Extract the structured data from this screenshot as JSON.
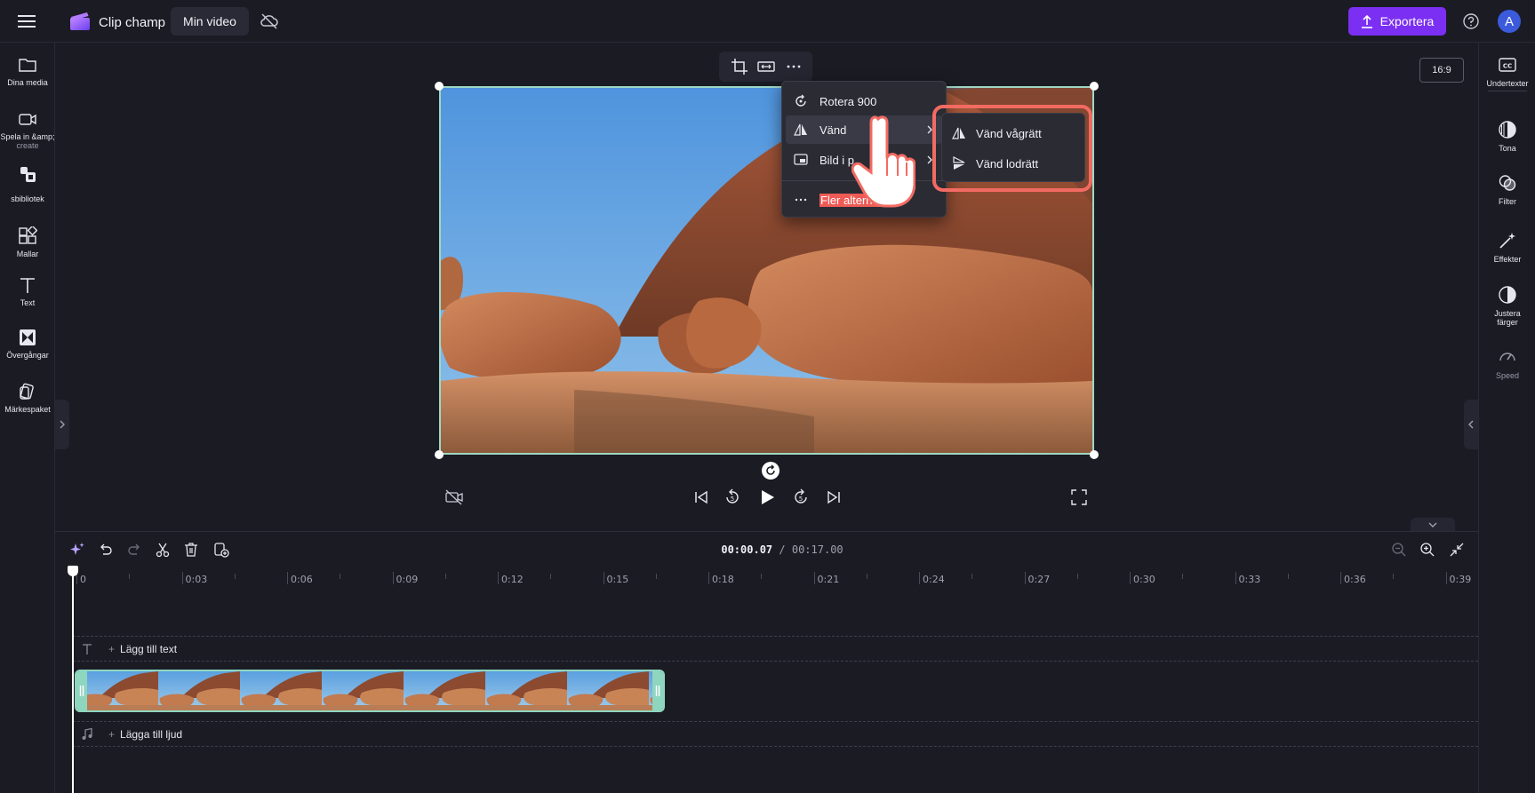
{
  "app": {
    "name": "Clip champ",
    "project_tab": "Min video"
  },
  "header": {
    "export_label": "Exportera",
    "avatar_initial": "A"
  },
  "left_sidebar": {
    "items": [
      {
        "label": "Dina media",
        "icon": "folder-icon"
      },
      {
        "label": "Spela in &amp;",
        "sublabel": "create",
        "icon": "camera-icon"
      },
      {
        "label": "sbibliotek",
        "icon": "content-library-icon"
      },
      {
        "label": "Mallar",
        "icon": "templates-icon"
      },
      {
        "label": "Text",
        "icon": "text-icon"
      },
      {
        "label": "Övergångar",
        "icon": "transitions-icon"
      },
      {
        "label": "Märkespaket",
        "icon": "brand-kit-icon"
      }
    ]
  },
  "right_sidebar": {
    "items": [
      {
        "label": "Undertexter",
        "icon": "captions-icon"
      },
      {
        "label": "Tona",
        "icon": "fade-icon"
      },
      {
        "label": "Filter",
        "icon": "filter-icon"
      },
      {
        "label": "Effekter",
        "icon": "effects-icon"
      },
      {
        "label": "Justera",
        "sublabel": "färger",
        "icon": "adjust-colors-icon"
      },
      {
        "label": "Speed",
        "icon": "speed-icon"
      }
    ]
  },
  "preview": {
    "aspect_ratio": "16:9",
    "toolbar": {
      "icons": [
        "crop-icon",
        "fit-icon",
        "more-icon"
      ]
    }
  },
  "context_menu": {
    "items": [
      {
        "label": "Rotera 900",
        "icon": "rotate-icon"
      },
      {
        "label": "Vänd",
        "icon": "flip-icon",
        "has_submenu": true
      },
      {
        "label": "Bild i p",
        "icon": "picture-in-picture-icon",
        "has_submenu": true
      },
      {
        "label": "Fler alternativ",
        "icon": "more-icon"
      }
    ],
    "submenu": {
      "items": [
        {
          "label": "Vänd vågrätt",
          "icon": "flip-horizontal-icon"
        },
        {
          "label": "Vänd lodrätt",
          "icon": "flip-vertical-icon"
        }
      ]
    }
  },
  "timeline": {
    "time_current": "00:00.07",
    "time_separator": " / ",
    "time_total": "00:17.00",
    "ticks": [
      "0",
      "0:03",
      "0:06",
      "0:09",
      "0:12",
      "0:15",
      "0:18",
      "0:21",
      "0:24",
      "0:27",
      "0:30",
      "0:33",
      "0:36",
      "0:39"
    ],
    "add_text_label": "Lägg till text",
    "add_audio_label": "Lägga till ljud",
    "plus": "+"
  },
  "colors": {
    "accent": "#7b2ff2",
    "clip_border": "#8fd6bf",
    "highlight": "#f26b62",
    "background": "#1b1b24"
  }
}
